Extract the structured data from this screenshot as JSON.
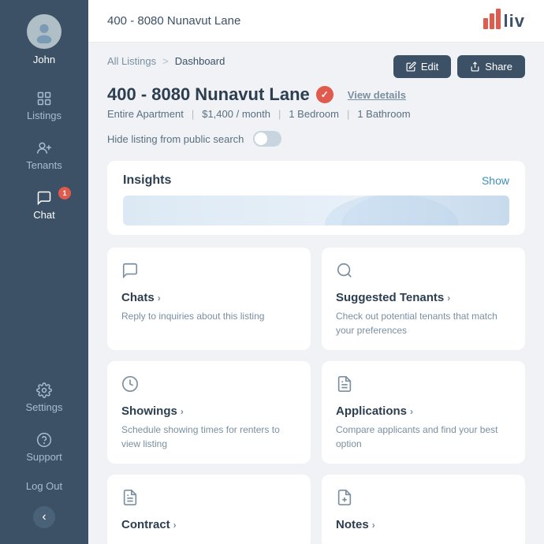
{
  "topbar": {
    "title": "400 - 8080 Nunavut Lane",
    "logo_icon": "📊",
    "logo_text": "liv"
  },
  "sidebar": {
    "user": {
      "name": "John"
    },
    "nav_items": [
      {
        "id": "listings",
        "label": "Listings",
        "has_arrow": true
      },
      {
        "id": "tenants",
        "label": "Tenants",
        "has_badge": false
      },
      {
        "id": "chat",
        "label": "Chat",
        "badge": "1"
      }
    ],
    "bottom_items": [
      {
        "id": "settings",
        "label": "Settings"
      },
      {
        "id": "support",
        "label": "Support"
      }
    ],
    "logout_label": "Log Out",
    "collapse_icon": "‹"
  },
  "breadcrumb": {
    "all_listings": "All Listings",
    "separator": ">",
    "current": "Dashboard"
  },
  "listing": {
    "title": "400 - 8080 Nunavut Lane",
    "view_details_label": "View details",
    "verified": true,
    "type": "Entire Apartment",
    "price": "$1,400 / month",
    "bedrooms": "1 Bedroom",
    "bathrooms": "1 Bathroom",
    "hide_label": "Hide listing from public search"
  },
  "buttons": {
    "edit_label": "Edit",
    "share_label": "Share"
  },
  "insights": {
    "title": "Insights",
    "show_label": "Show"
  },
  "cards": [
    {
      "id": "chats",
      "title": "Chats",
      "desc": "Reply to inquiries about this listing",
      "icon": "chat"
    },
    {
      "id": "suggested-tenants",
      "title": "Suggested Tenants",
      "desc": "Check out potential tenants that match your preferences",
      "icon": "search"
    },
    {
      "id": "showings",
      "title": "Showings",
      "desc": "Schedule showing times for renters to view listing",
      "icon": "clock"
    },
    {
      "id": "applications",
      "title": "Applications",
      "desc": "Compare applicants and find your best option",
      "icon": "file"
    },
    {
      "id": "contract",
      "title": "Contract",
      "desc": "",
      "icon": "contract"
    },
    {
      "id": "notes",
      "title": "Notes",
      "desc": "",
      "icon": "notes"
    }
  ]
}
